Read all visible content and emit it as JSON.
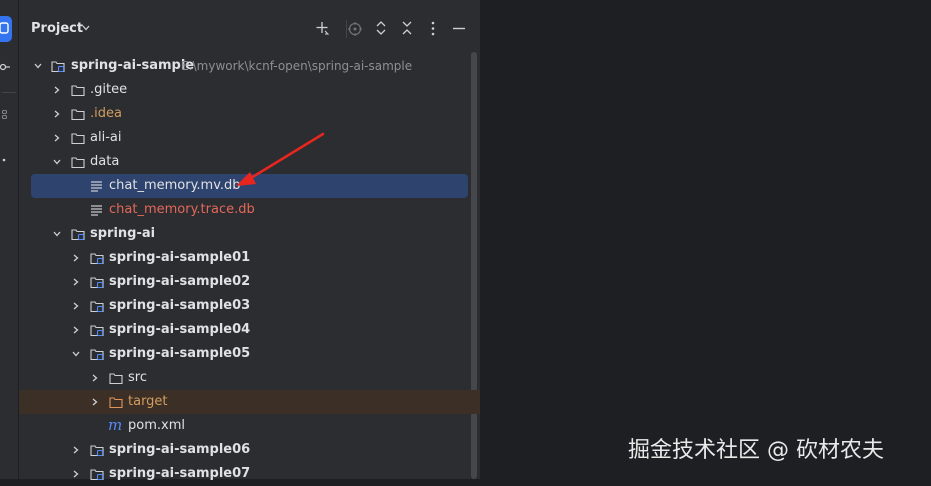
{
  "panel": {
    "title": "Project",
    "actions": [
      "add-icon",
      "locate-icon",
      "expand-all-icon",
      "collapse-all-icon",
      "more-icon",
      "minimize-icon"
    ]
  },
  "tree": {
    "root": {
      "label": "spring-ai-sample",
      "path": "E:\\mywork\\kcnf-open\\spring-ai-sample"
    },
    "gitee": ".gitee",
    "idea": ".idea",
    "ali_ai": "ali-ai",
    "data": "data",
    "chat_memory_mv": "chat_memory.mv.db",
    "chat_memory_trace": "chat_memory.trace.db",
    "spring_ai": "spring-ai",
    "sample01": "spring-ai-sample01",
    "sample02": "spring-ai-sample02",
    "sample03": "spring-ai-sample03",
    "sample04": "spring-ai-sample04",
    "sample05": "spring-ai-sample05",
    "src": "src",
    "target": "target",
    "pom": "pom.xml",
    "sample06": "spring-ai-sample06",
    "sample07": "spring-ai-sample07"
  },
  "colors": {
    "accent": "#3574f0",
    "selection": "#2e436e",
    "excluded_bg": "#3b2f26",
    "ignored_orange": "#d29d5e",
    "error_red": "#e3685a",
    "annotation_arrow": "#e8261f"
  },
  "watermark": "掘金技术社区 @ 砍材农夫"
}
